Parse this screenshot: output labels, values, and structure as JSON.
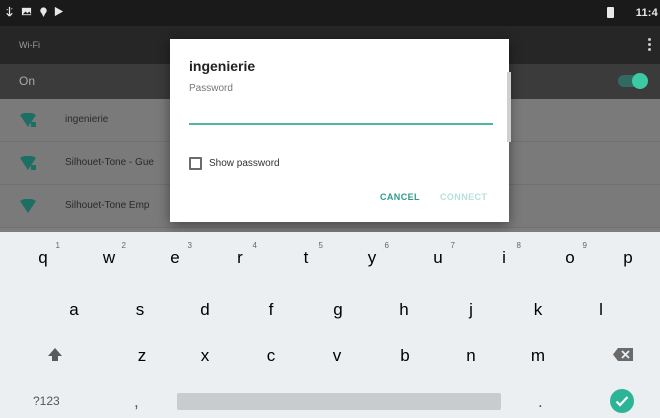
{
  "status_bar": {
    "time": "11:4"
  },
  "app_bar": {
    "title": "Wi-Fi"
  },
  "wifi_toggle": {
    "label": "On",
    "enabled": true,
    "accent": "#3ec9a5"
  },
  "networks": [
    {
      "name": "ingenierie"
    },
    {
      "name": "Silhouet-Tone - Gue"
    },
    {
      "name": "Silhouet-Tone Emp"
    }
  ],
  "dialog": {
    "title": "ingenierie",
    "password_label": "Password",
    "password_value": "",
    "show_password_label": "Show password",
    "show_password_checked": false,
    "cancel_label": "CANCEL",
    "connect_label": "CONNECT",
    "accent": "#2e9a8b"
  },
  "keyboard": {
    "row1": [
      {
        "key": "q",
        "hint": "1"
      },
      {
        "key": "w",
        "hint": "2"
      },
      {
        "key": "e",
        "hint": "3"
      },
      {
        "key": "r",
        "hint": "4"
      },
      {
        "key": "t",
        "hint": "5"
      },
      {
        "key": "y",
        "hint": "6"
      },
      {
        "key": "u",
        "hint": "7"
      },
      {
        "key": "i",
        "hint": "8"
      },
      {
        "key": "o",
        "hint": "9"
      },
      {
        "key": "p",
        "hint": ""
      }
    ],
    "row2": [
      "a",
      "s",
      "d",
      "f",
      "g",
      "h",
      "j",
      "k",
      "l"
    ],
    "row3": [
      "z",
      "x",
      "c",
      "v",
      "b",
      "n",
      "m"
    ],
    "symbols_label": "?123",
    "comma": ",",
    "period": ".",
    "icons": {
      "shift": "shift-icon",
      "backspace": "backspace-icon",
      "enter": "check-icon"
    },
    "enter_color": "#2bb596"
  }
}
